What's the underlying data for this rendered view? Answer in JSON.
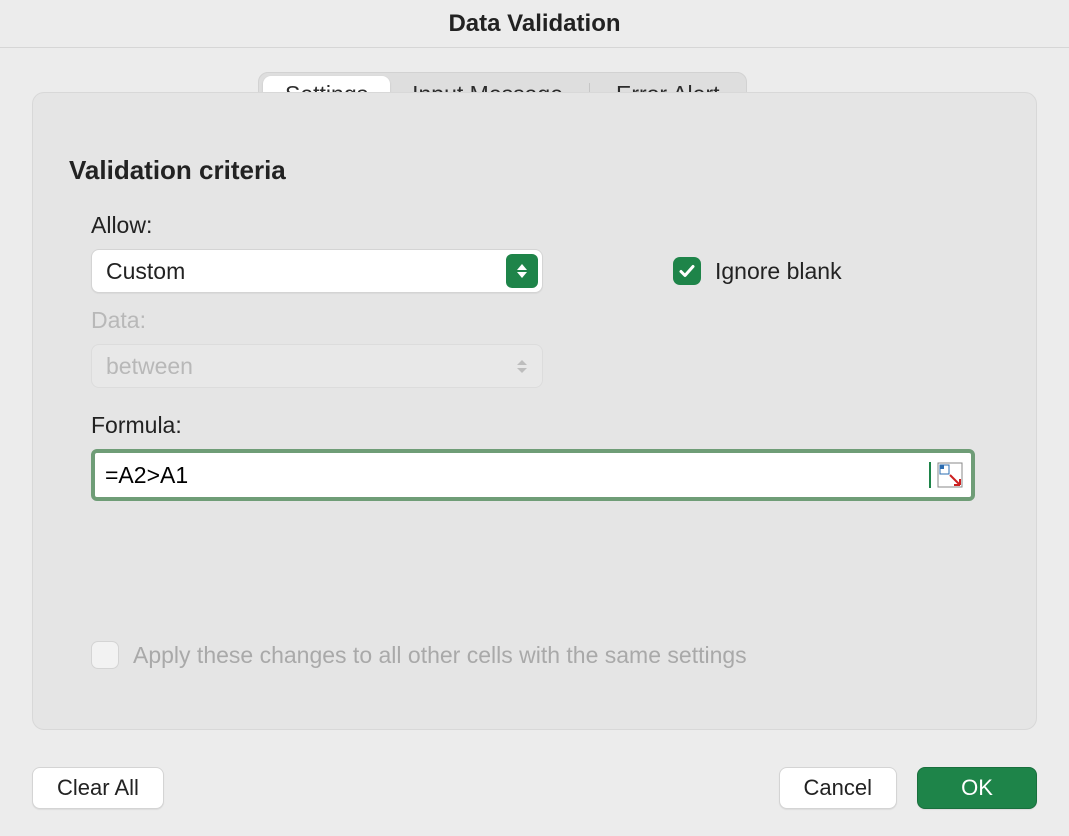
{
  "title": "Data Validation",
  "tabs": {
    "settings": "Settings",
    "inputMessage": "Input Message",
    "errorAlert": "Error Alert",
    "activeIndex": 0
  },
  "section": {
    "heading": "Validation criteria",
    "allowLabel": "Allow:",
    "allowValue": "Custom",
    "ignoreBlankLabel": "Ignore blank",
    "ignoreBlankChecked": true,
    "dataLabel": "Data:",
    "dataValue": "between",
    "dataEnabled": false,
    "formulaLabel": "Formula:",
    "formulaValue": "=A2>A1",
    "applyAllLabel": "Apply these changes to all other cells with the same settings",
    "applyAllChecked": false,
    "applyAllEnabled": false
  },
  "buttons": {
    "clearAll": "Clear All",
    "cancel": "Cancel",
    "ok": "OK"
  }
}
